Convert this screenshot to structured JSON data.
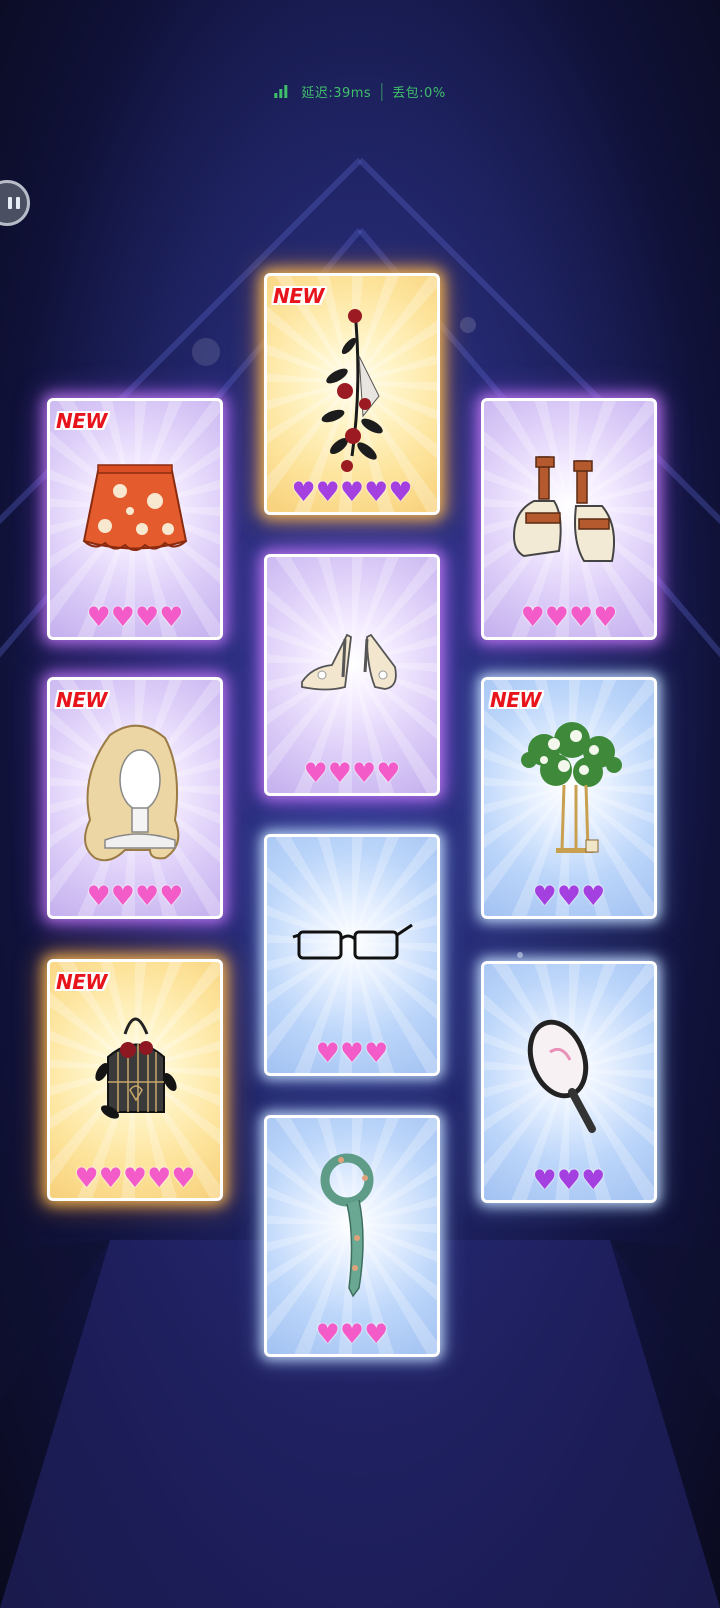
{
  "status": {
    "latency": "延迟:39ms",
    "packet_loss": "丢包:0%"
  },
  "colors": {
    "heart_pink": "#f35bc8",
    "heart_purple": "#a540e0",
    "new_badge": "#e8141c",
    "status_green": "#3fbf6a"
  },
  "new_label": "NEW",
  "cards": [
    {
      "id": "rose-corsage",
      "rarity": "gold",
      "new": true,
      "hearts": 5,
      "heart_color": "purple",
      "icon": "rose-corsage-icon"
    },
    {
      "id": "floral-skirt",
      "rarity": "purple",
      "new": true,
      "hearts": 4,
      "heart_color": "pink",
      "icon": "floral-skirt-icon"
    },
    {
      "id": "platform-sandals",
      "rarity": "purple",
      "new": false,
      "hearts": 4,
      "heart_color": "pink",
      "icon": "platform-sandals-icon"
    },
    {
      "id": "heels",
      "rarity": "purple",
      "new": false,
      "hearts": 4,
      "heart_color": "pink",
      "icon": "high-heels-icon"
    },
    {
      "id": "wavy-wig",
      "rarity": "purple",
      "new": true,
      "hearts": 4,
      "heart_color": "pink",
      "icon": "wig-icon"
    },
    {
      "id": "flower-stand",
      "rarity": "blue",
      "new": true,
      "hearts": 3,
      "heart_color": "purple",
      "icon": "flower-stand-icon"
    },
    {
      "id": "glasses",
      "rarity": "blue",
      "new": false,
      "hearts": 3,
      "heart_color": "pink",
      "icon": "glasses-icon"
    },
    {
      "id": "birdcage-bag",
      "rarity": "gold",
      "new": true,
      "hearts": 5,
      "heart_color": "pink",
      "icon": "birdcage-bag-icon"
    },
    {
      "id": "tennis-racket",
      "rarity": "blue",
      "new": false,
      "hearts": 3,
      "heart_color": "purple",
      "icon": "tennis-racket-icon"
    },
    {
      "id": "scarf",
      "rarity": "blue",
      "new": false,
      "hearts": 3,
      "heart_color": "pink",
      "icon": "scarf-icon"
    }
  ]
}
